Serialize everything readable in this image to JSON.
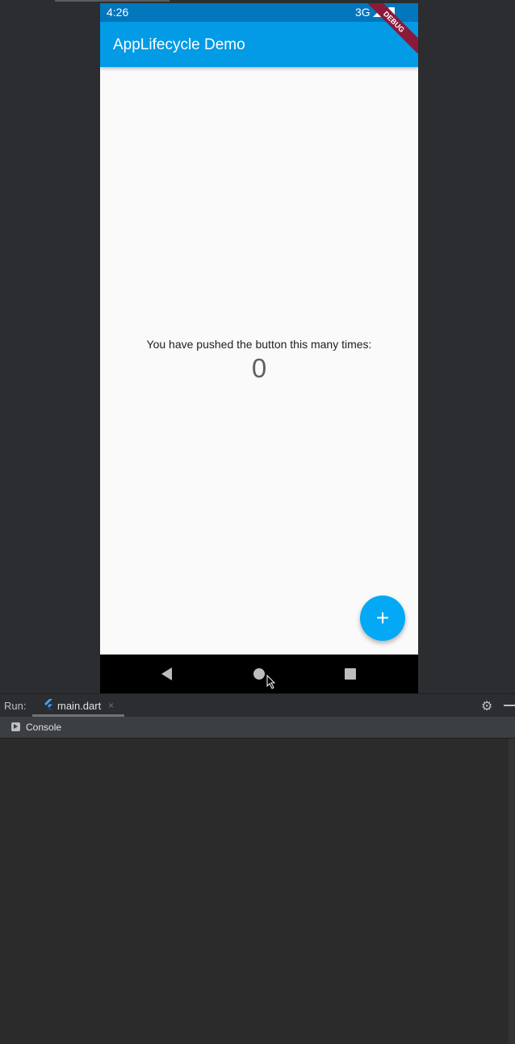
{
  "device": {
    "status_bar": {
      "time": "4:26",
      "network": "3G",
      "signal_icon": "signal-icon",
      "battery_icon": "battery-icon"
    },
    "app_bar": {
      "title": "AppLifecycle Demo",
      "color": "#039be5"
    },
    "debug_banner": "DEBUG",
    "body": {
      "message": "You have pushed the button this many times:",
      "counter": "0"
    },
    "fab": {
      "icon": "plus-icon",
      "glyph": "+",
      "color": "#03a9f4"
    },
    "nav_bar": {
      "back_icon": "back-icon",
      "home_icon": "home-icon",
      "recents_icon": "recents-icon"
    }
  },
  "run_panel": {
    "label": "Run:",
    "tab": {
      "label": "main.dart",
      "icon": "flutter-icon",
      "close": "×"
    },
    "settings_icon": "gear-icon",
    "minimize_icon": "minimize-icon",
    "console": {
      "label": "Console",
      "icon": "console-icon"
    }
  }
}
